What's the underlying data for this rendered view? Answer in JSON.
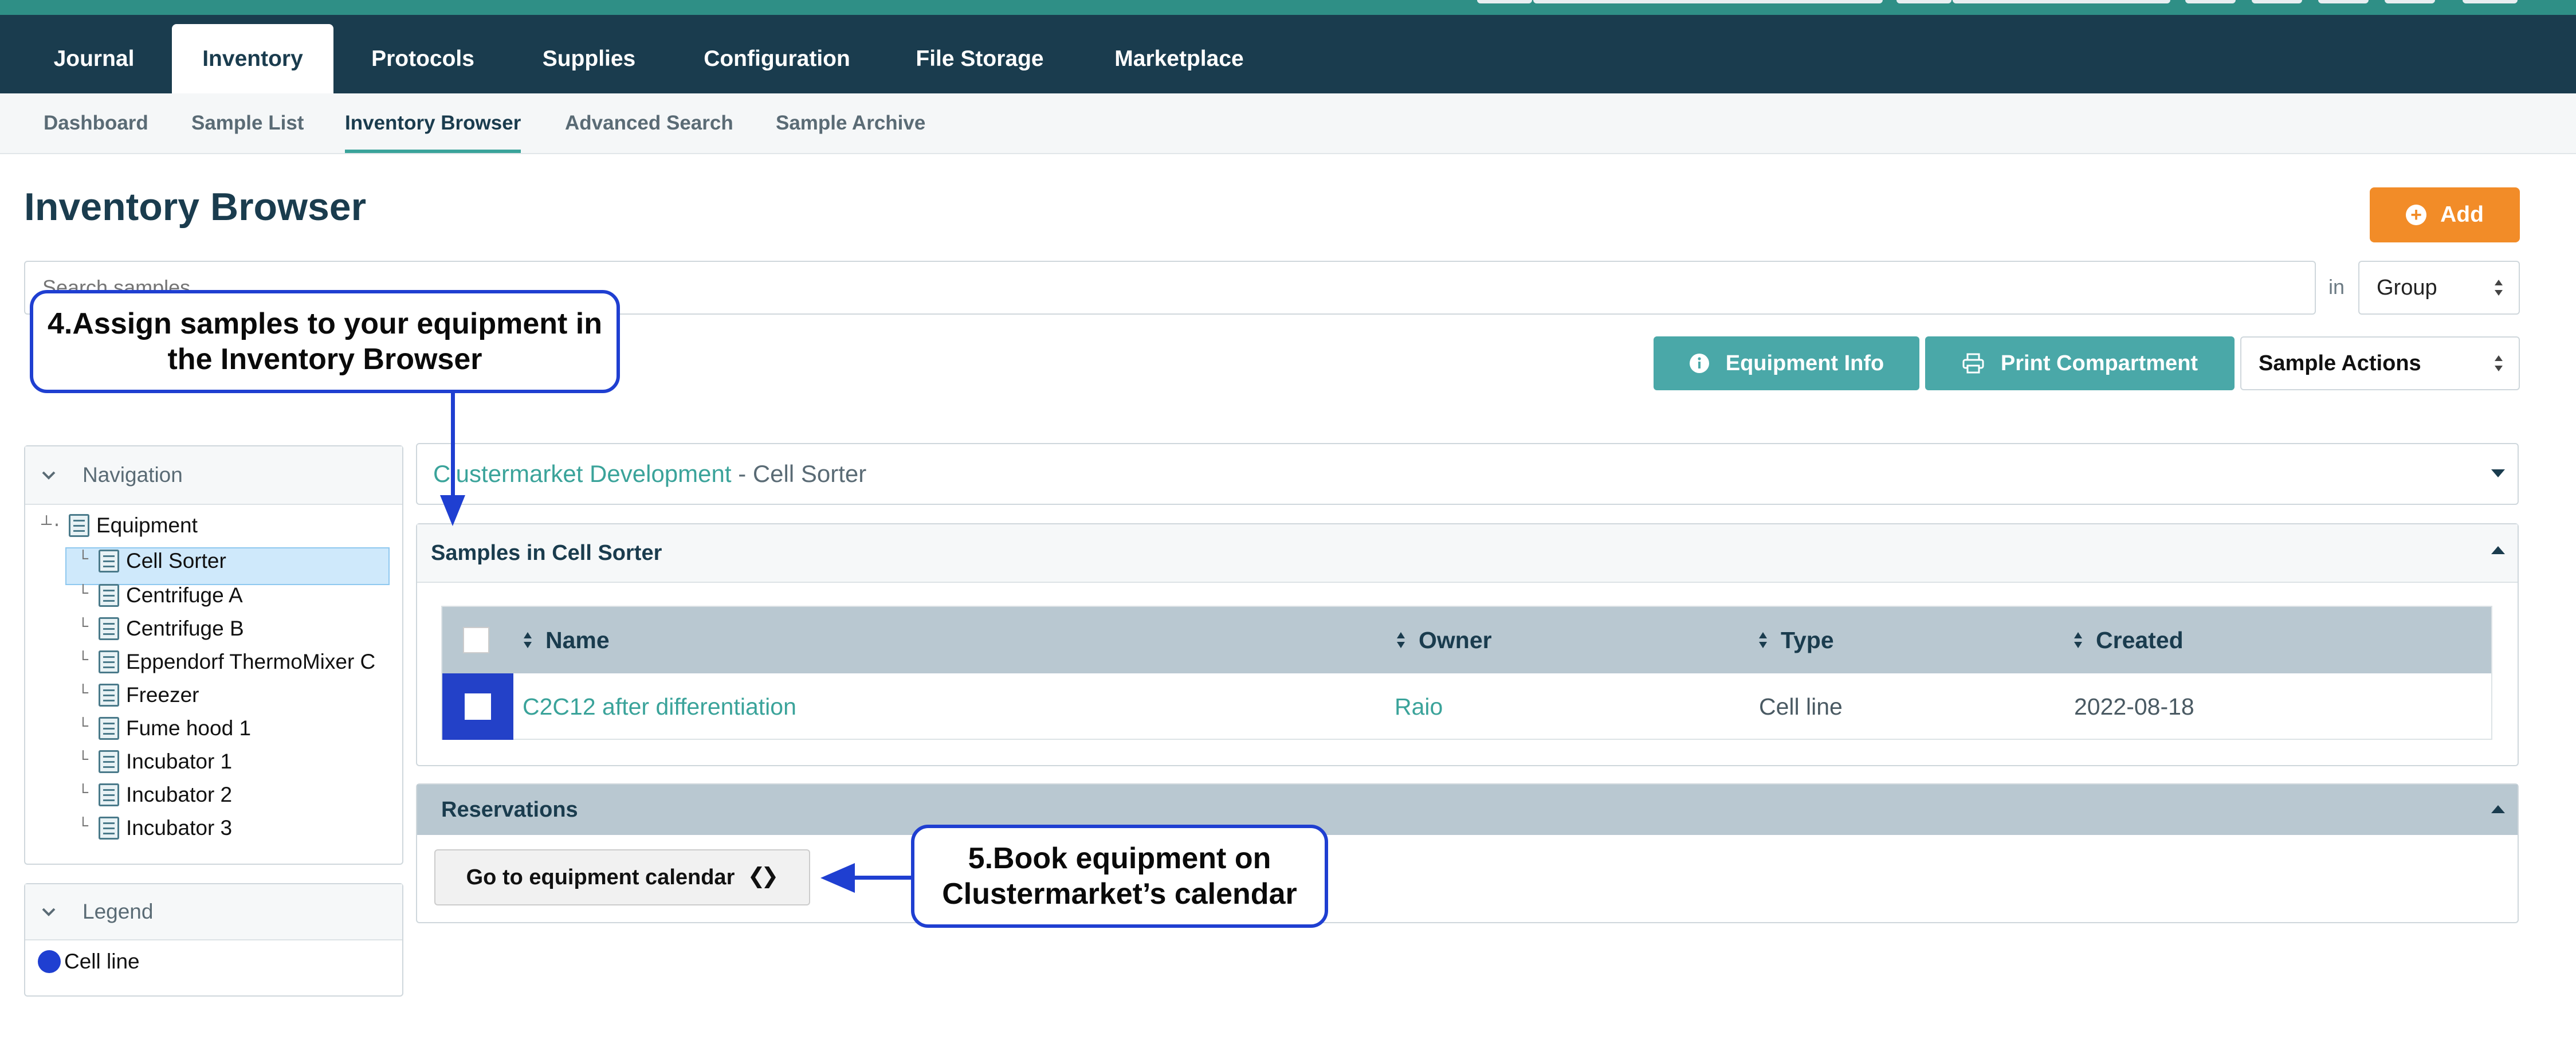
{
  "colors": {
    "nav_bg": "#1a3c4e",
    "accent_teal": "#4aa8a8",
    "link_teal": "#3aa39a",
    "add_orange": "#f28c28",
    "callout_blue": "#1f3fd1"
  },
  "top_nav": {
    "tabs": [
      {
        "label": "Journal"
      },
      {
        "label": "Inventory",
        "active": true
      },
      {
        "label": "Protocols"
      },
      {
        "label": "Supplies"
      },
      {
        "label": "Configuration"
      },
      {
        "label": "File Storage"
      },
      {
        "label": "Marketplace"
      }
    ]
  },
  "sub_nav": {
    "items": [
      {
        "label": "Dashboard"
      },
      {
        "label": "Sample List"
      },
      {
        "label": "Inventory Browser",
        "active": true
      },
      {
        "label": "Advanced Search"
      },
      {
        "label": "Sample Archive"
      }
    ]
  },
  "page": {
    "title": "Inventory Browser",
    "add_label": "Add",
    "add_icon": "plus-circle-icon"
  },
  "search": {
    "placeholder": "Search samples",
    "in_label": "in",
    "scope_value": "Group"
  },
  "actions": {
    "equipment_info": "Equipment Info",
    "print_compartment": "Print Compartment",
    "sample_actions": "Sample Actions"
  },
  "callouts": {
    "step4": "4.Assign samples to your equipment in the Inventory Browser",
    "step5": "5.Book equipment on Clustermarket’s calendar"
  },
  "navigation": {
    "title": "Navigation",
    "root": "Equipment",
    "items": [
      "Cell Sorter",
      "Centrifuge A",
      "Centrifuge B",
      "Eppendorf ThermoMixer C",
      "Freezer",
      "Fume hood 1",
      "Incubator 1",
      "Incubator 2",
      "Incubator 3"
    ],
    "selected": "Cell Sorter"
  },
  "legend": {
    "title": "Legend",
    "items": [
      {
        "label": "Cell line",
        "color": "#1f3fd1"
      }
    ]
  },
  "breadcrumb": {
    "link": "Clustermarket Development",
    "rest": " - Cell Sorter"
  },
  "samples": {
    "title": "Samples in Cell Sorter",
    "columns": [
      "Name",
      "Owner",
      "Type",
      "Created"
    ],
    "rows": [
      {
        "name": "C2C12 after differentiation",
        "owner": "Raio",
        "type": "Cell line",
        "created": "2022-08-18"
      }
    ]
  },
  "reservations": {
    "title": "Reservations",
    "calendar_button": "Go to equipment calendar"
  }
}
